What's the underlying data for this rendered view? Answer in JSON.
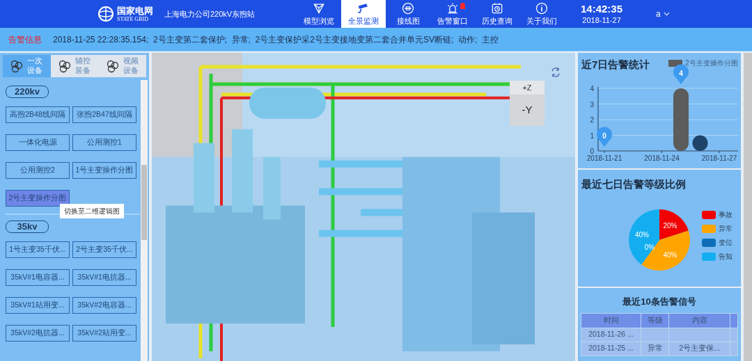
{
  "header": {
    "logo_text": "国家电网",
    "logo_subtext": "STATE GRID",
    "station": "上海电力公司220kV东煦站",
    "nav": [
      {
        "label": "模型浏览",
        "selected": false,
        "alert": false
      },
      {
        "label": "全景监测",
        "selected": true,
        "alert": false
      },
      {
        "label": "接线图",
        "selected": false,
        "alert": false
      },
      {
        "label": "告警窗口",
        "selected": false,
        "alert": true
      },
      {
        "label": "历史查询",
        "selected": false,
        "alert": false
      },
      {
        "label": "关于我们",
        "selected": false,
        "alert": false
      }
    ],
    "time": "14:42:35",
    "date": "2018-11-27",
    "user": "a"
  },
  "alarm_bar": {
    "label": "告警信息",
    "message": "2018-11-25 22:28:35.154;  2号主变第二套保护;  异常;  2号主变保护采2号主变接地变第二套合并单元SV断链;  动作;  主控"
  },
  "sidebar": {
    "tabs": [
      {
        "label": "一次设备",
        "selected": true
      },
      {
        "label": "辅控装备",
        "selected": false
      },
      {
        "label": "视频设备",
        "selected": false
      }
    ],
    "groups": [
      {
        "title": "220kv",
        "items": [
          {
            "label": "高煦2B48线间隔",
            "selected": false
          },
          {
            "label": "张煦2B47线间隔",
            "selected": false
          },
          {
            "label": "一体化电源",
            "selected": false
          },
          {
            "label": "公用测控1",
            "selected": false
          },
          {
            "label": "公用测控2",
            "selected": false
          },
          {
            "label": "1号主变操作分图",
            "selected": false
          },
          {
            "label": "2号主变操作分图",
            "selected": true,
            "tooltip": "切换至二维逻辑图"
          }
        ]
      },
      {
        "title": "35kv",
        "items": [
          {
            "label": "1号主变35千伏...",
            "selected": false
          },
          {
            "label": "2号主变35千伏...",
            "selected": false
          },
          {
            "label": "35kV#1电容器...",
            "selected": false
          },
          {
            "label": "35kV#1电抗器...",
            "selected": false
          },
          {
            "label": "35kV#1站用变...",
            "selected": false
          },
          {
            "label": "35kV#2电容器...",
            "selected": false
          },
          {
            "label": "35kV#2电抗器...",
            "selected": false
          },
          {
            "label": "35kV#2站用变...",
            "selected": false
          }
        ]
      }
    ]
  },
  "viewer": {
    "cube_top": "+Z",
    "cube_front": "-Y"
  },
  "alarm_stats": {
    "title": "近7日告警统计",
    "chart_data": {
      "type": "bar",
      "categories": [
        "2018-11-21",
        null,
        null,
        "2018-11-24",
        null,
        null,
        "2018-11-27"
      ],
      "series": [
        {
          "name": "2号主变操作分图",
          "color": "#5c5c5c",
          "values": [
            0,
            0,
            0,
            0,
            4,
            0,
            0
          ]
        },
        {
          "color": "#1d4468",
          "values": [
            0,
            0,
            0,
            0,
            0,
            1,
            0
          ]
        }
      ],
      "yticks": [
        0,
        1,
        2,
        3,
        4
      ],
      "ylim": [
        0,
        4
      ],
      "grid": true,
      "annotations": [
        {
          "x": "2018-11-21",
          "y": 0,
          "text": "0"
        },
        {
          "y": 4,
          "text": "4"
        }
      ]
    }
  },
  "level_ratio": {
    "title": "最近七日告警等级比例",
    "chart_data": {
      "type": "pie",
      "categories": [
        "事故",
        "异常",
        "变位",
        "告知"
      ],
      "series": [
        {
          "values": [
            20,
            40,
            0,
            40
          ]
        }
      ],
      "colors": [
        "#f00000",
        "#ffa500",
        "#0e6fb8",
        "#14aef0"
      ],
      "value_labels": [
        "20%",
        "40%",
        "0%",
        "40%"
      ]
    }
  },
  "recent_signals": {
    "title": "最近10条告警信号",
    "columns": [
      "时间",
      "等级",
      "内容"
    ],
    "rows": [
      [
        "2018-11-26 ...",
        "",
        ""
      ],
      [
        "2018-11-25 ...",
        "异常",
        "2号主变保..."
      ]
    ]
  }
}
